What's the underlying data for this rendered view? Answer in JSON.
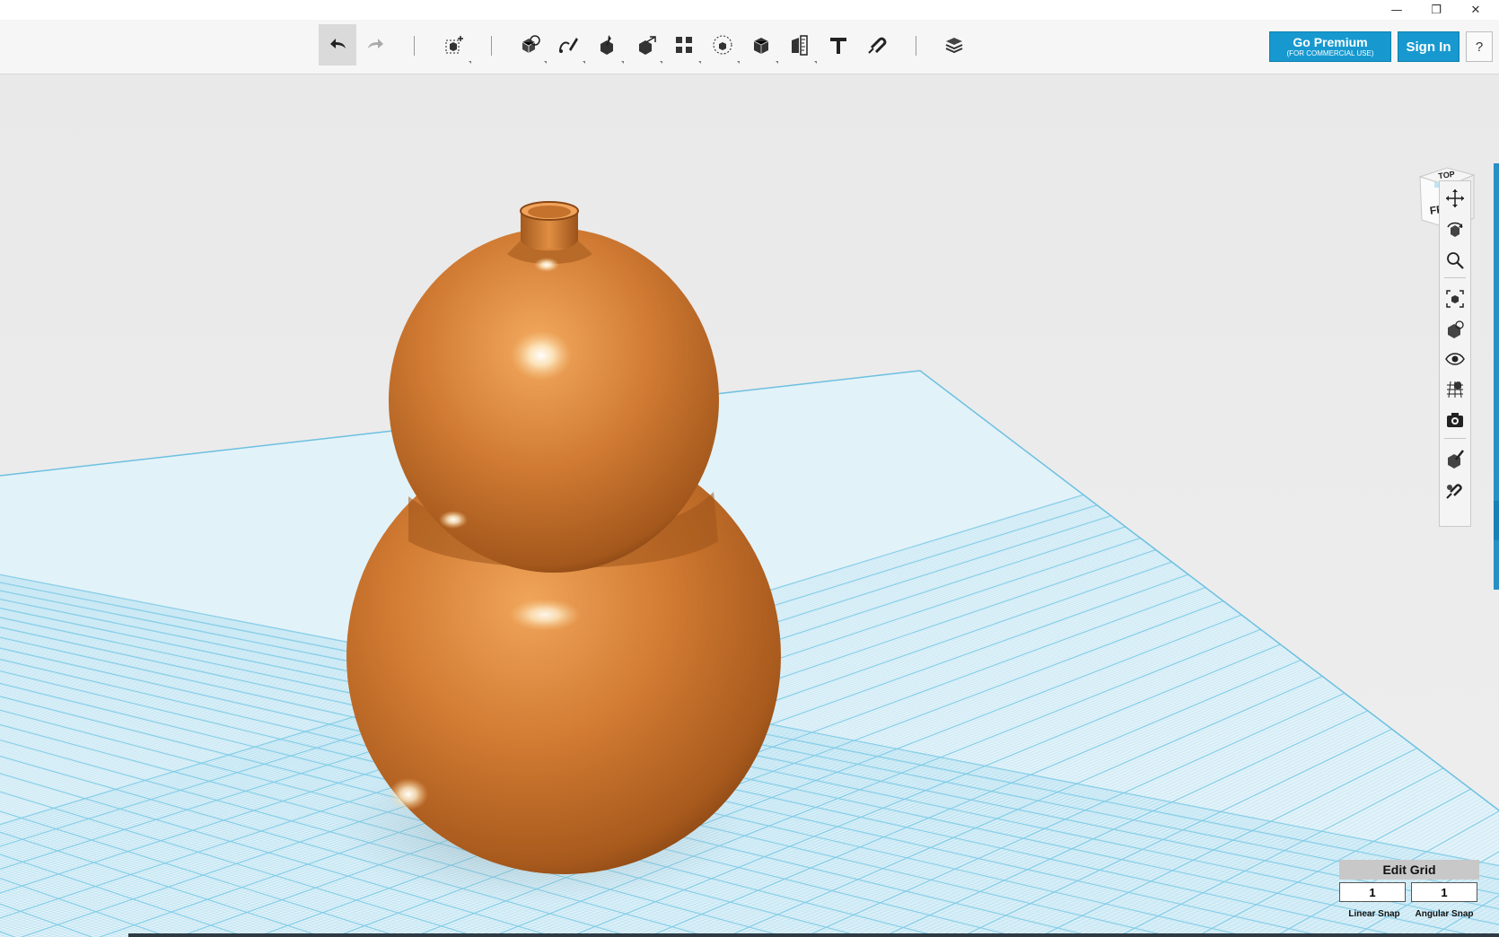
{
  "window": {
    "minimize_icon": "minimize-icon",
    "restore_icon": "restore-icon",
    "close_icon": "close-icon"
  },
  "toolbar": {
    "tools": [
      "undo-icon",
      "redo-icon",
      "transform-icon",
      "primitives-icon",
      "sketch-icon",
      "construct-icon",
      "modify-icon",
      "pattern-icon",
      "grouping-icon",
      "combine-icon",
      "measure-icon",
      "text-icon",
      "snap-icon",
      "material-icon"
    ],
    "premium_label": "Go Premium",
    "premium_sub": "(FOR COMMERCIAL USE)",
    "signin_label": "Sign In",
    "help_label": "?"
  },
  "viewcube": {
    "top_label": "TOP",
    "front_label": "FRONT"
  },
  "right_panel": {
    "tools": [
      "pan-icon",
      "orbit-icon",
      "zoom-icon",
      "fit-icon",
      "perspective-icon",
      "visibility-icon",
      "grid-icon",
      "screenshot-icon",
      "material-edit-icon",
      "snap-magnet-icon"
    ]
  },
  "edit_grid": {
    "title": "Edit Grid",
    "linear_snap_value": "1",
    "angular_snap_value": "1",
    "linear_snap_label": "Linear Snap",
    "angular_snap_label": "Angular Snap"
  },
  "colors": {
    "accent": "#1799d0",
    "grid_line": "#7fcbe6",
    "grid_fill": "#dff2fa",
    "model": "#c8702a"
  }
}
